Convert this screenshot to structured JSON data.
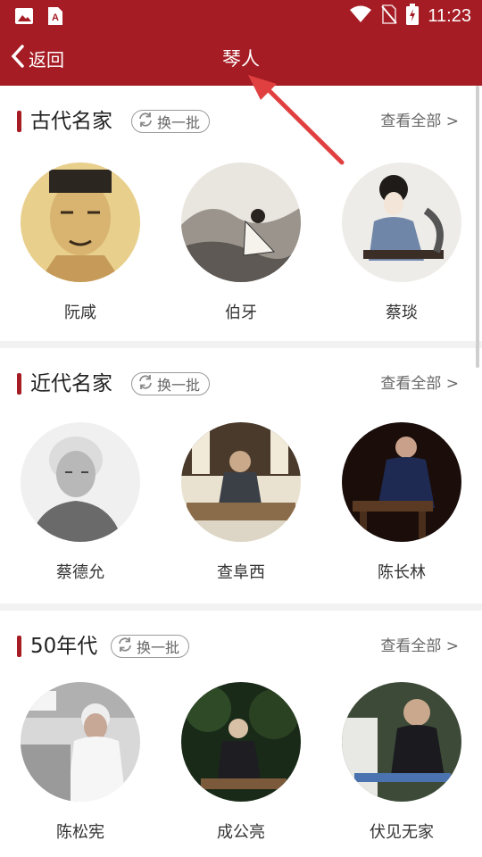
{
  "status_bar": {
    "time": "11:23",
    "icons_left": [
      "image-icon",
      "text-app-icon"
    ],
    "icons_right": [
      "wifi-icon",
      "no-sim-icon",
      "battery-charging-icon"
    ]
  },
  "nav": {
    "back_label": "返回",
    "title": "琴人"
  },
  "sections": [
    {
      "title": "古代名家",
      "refresh_label": "换一批",
      "see_all_label": "查看全部 >",
      "people": [
        {
          "name": "阮咸"
        },
        {
          "name": "伯牙"
        },
        {
          "name": "蔡琰"
        }
      ]
    },
    {
      "title": "近代名家",
      "refresh_label": "换一批",
      "see_all_label": "查看全部 >",
      "people": [
        {
          "name": "蔡德允"
        },
        {
          "name": "查阜西"
        },
        {
          "name": "陈长林"
        }
      ]
    },
    {
      "title": "50年代",
      "refresh_label": "换一批",
      "see_all_label": "查看全部 >",
      "people": [
        {
          "name": "陈松宪"
        },
        {
          "name": "成公亮"
        },
        {
          "name": "伏见无家"
        }
      ]
    }
  ],
  "colors": {
    "brand": "#a51c24",
    "annotation_arrow": "#e04040"
  }
}
